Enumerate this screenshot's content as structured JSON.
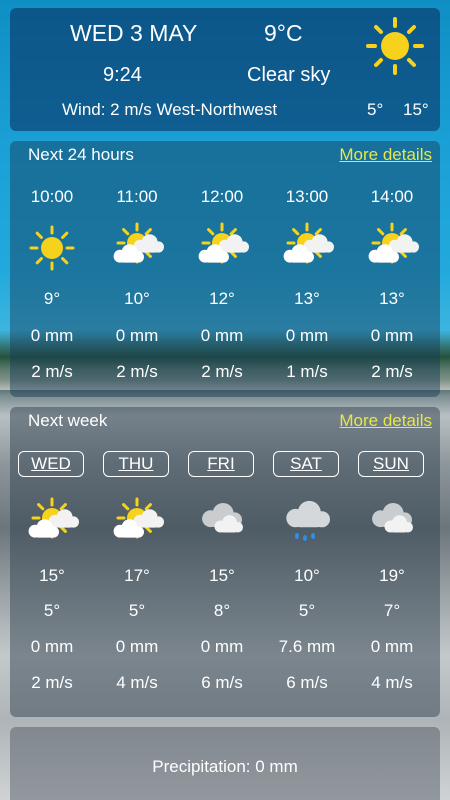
{
  "current": {
    "date": "WED 3 MAY",
    "temp": "9°C",
    "time": "9:24",
    "condition": "Clear sky",
    "wind": "Wind: 2 m/s West-Northwest",
    "low": "5°",
    "high": "15°",
    "icon": "sun-icon"
  },
  "hours": {
    "label": "Next 24 hours",
    "more": "More details",
    "items": [
      {
        "time": "10:00",
        "icon": "sun-icon",
        "temp": "9°",
        "precip": "0 mm",
        "wind": "2 m/s"
      },
      {
        "time": "11:00",
        "icon": "partly-cloudy-icon",
        "temp": "10°",
        "precip": "0 mm",
        "wind": "2 m/s"
      },
      {
        "time": "12:00",
        "icon": "partly-cloudy-icon",
        "temp": "12°",
        "precip": "0 mm",
        "wind": "2 m/s"
      },
      {
        "time": "13:00",
        "icon": "partly-cloudy-icon",
        "temp": "13°",
        "precip": "0 mm",
        "wind": "1 m/s"
      },
      {
        "time": "14:00",
        "icon": "partly-cloudy-icon",
        "temp": "13°",
        "precip": "0 mm",
        "wind": "2 m/s"
      }
    ]
  },
  "week": {
    "label": "Next week",
    "more": "More details",
    "days": [
      {
        "day": "WED",
        "icon": "partly-cloudy-icon",
        "high": "15°",
        "low": "5°",
        "precip": "0 mm",
        "wind": "2 m/s"
      },
      {
        "day": "THU",
        "icon": "partly-cloudy-icon",
        "high": "17°",
        "low": "5°",
        "precip": "0 mm",
        "wind": "4 m/s"
      },
      {
        "day": "FRI",
        "icon": "cloudy-icon",
        "high": "15°",
        "low": "8°",
        "precip": "0 mm",
        "wind": "6 m/s"
      },
      {
        "day": "SAT",
        "icon": "rain-cloud-icon",
        "high": "10°",
        "low": "5°",
        "precip": "7.6 mm",
        "wind": "6 m/s"
      },
      {
        "day": "SUN",
        "icon": "cloudy-icon",
        "high": "19°",
        "low": "7°",
        "precip": "0 mm",
        "wind": "4 m/s"
      }
    ]
  },
  "precip": {
    "text": "Precipitation: 0 mm"
  },
  "colors": {
    "sun": "#f6d21c",
    "link": "#e7e64a"
  }
}
